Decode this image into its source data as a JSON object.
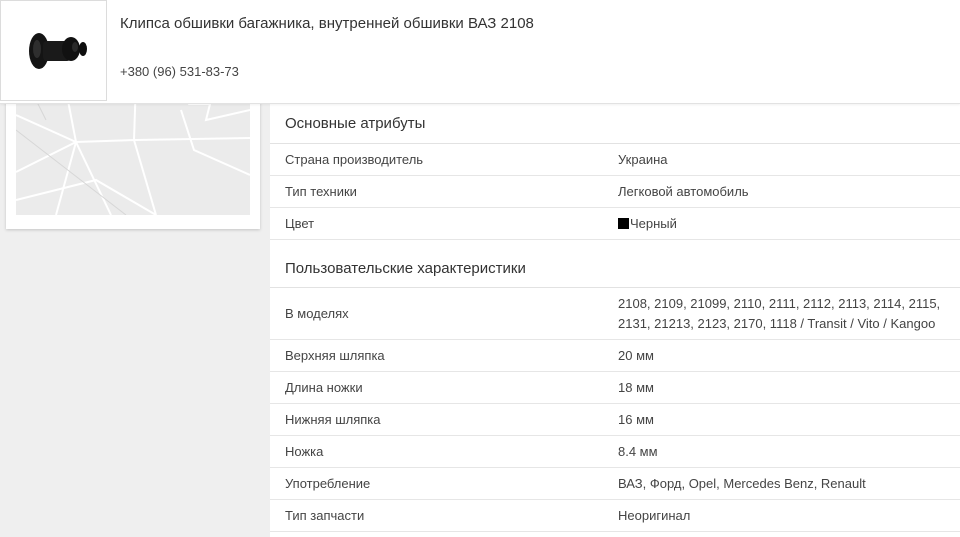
{
  "header": {
    "product_title": "Клипса обшивки багажника, внутренней обшивки ВАЗ 2108",
    "phone": "+380 (96) 531-83-73",
    "thumbnail_icon": "plastic-clip-image"
  },
  "map": {
    "icon": "map-preview"
  },
  "basic": {
    "title": "Основные атрибуты",
    "rows": [
      {
        "label": "Страна производитель",
        "value": "Украина"
      },
      {
        "label": "Тип техники",
        "value": "Легковой автомобиль"
      },
      {
        "label": "Цвет",
        "value": "Черный",
        "swatch": "#000000"
      }
    ]
  },
  "custom": {
    "title": "Пользовательские характеристики",
    "models": {
      "label": "В моделях",
      "line1": "2108, 2109, 21099, 2110, 2111, 2112, 2113, 2114, 2115,",
      "line2": "2131, 21213, 2123, 2170, 1118 / Transit / Vito / Kangoo"
    },
    "rows": [
      {
        "label": "Верхняя шляпка",
        "value": "20 мм"
      },
      {
        "label": "Длина ножки",
        "value": "18 мм"
      },
      {
        "label": "Нижняя шляпка",
        "value": "16 мм"
      },
      {
        "label": "Ножка",
        "value": "8.4 мм"
      },
      {
        "label": "Употребление",
        "value": "ВАЗ, Форд, Opel, Mercedes Benz, Renault"
      },
      {
        "label": "Тип запчасти",
        "value": "Неоригинал"
      }
    ]
  }
}
